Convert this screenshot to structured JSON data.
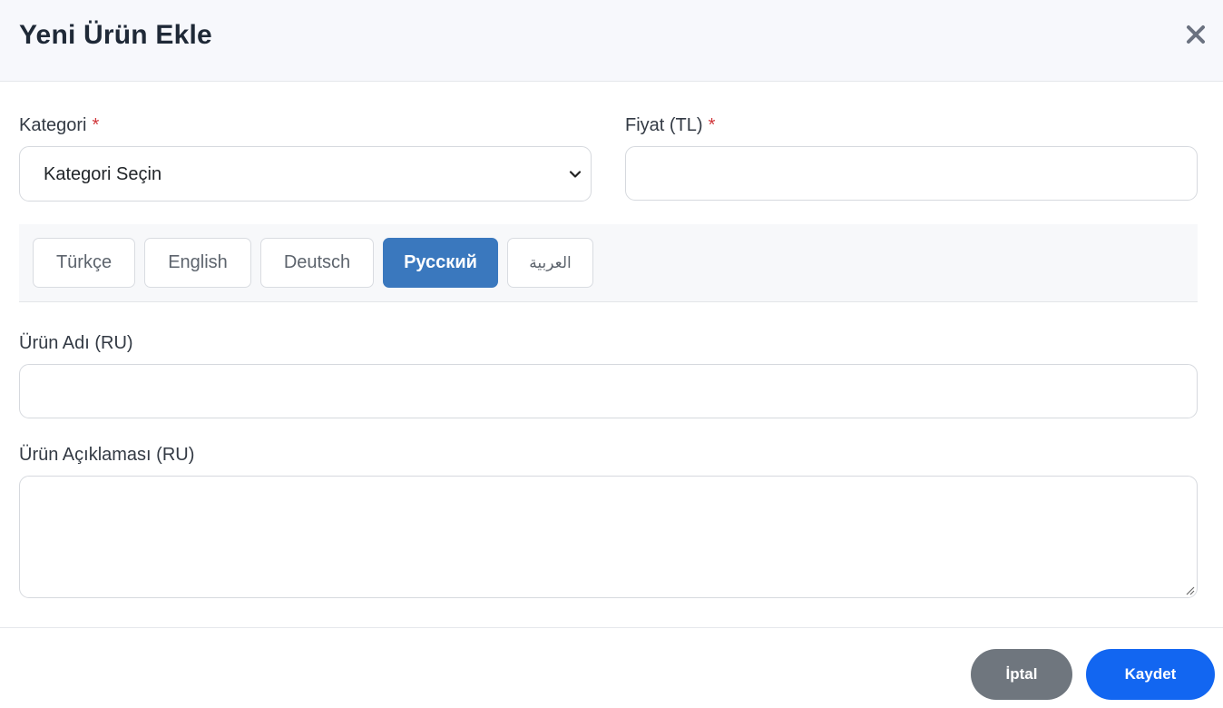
{
  "header": {
    "title": "Yeni Ürün Ekle",
    "close_icon": "close-icon"
  },
  "form": {
    "category": {
      "label": "Kategori",
      "required_mark": "*",
      "selected_value": "Kategori Seçin"
    },
    "price": {
      "label": "Fiyat (TL)",
      "required_mark": "*",
      "value": ""
    },
    "language_tabs": [
      {
        "label": "Türkçe",
        "active": false
      },
      {
        "label": "English",
        "active": false
      },
      {
        "label": "Deutsch",
        "active": false
      },
      {
        "label": "Русский",
        "active": true
      },
      {
        "label": "العربية",
        "active": false
      }
    ],
    "product_name": {
      "label": "Ürün Adı (RU)",
      "value": ""
    },
    "product_description": {
      "label": "Ürün Açıklaması (RU)",
      "value": ""
    }
  },
  "footer": {
    "cancel_label": "İptal",
    "save_label": "Kaydet"
  },
  "colors": {
    "active_tab": "#3a78be",
    "save_button": "#1266f1",
    "cancel_button": "#6f767e",
    "required_mark": "#d0363a"
  }
}
